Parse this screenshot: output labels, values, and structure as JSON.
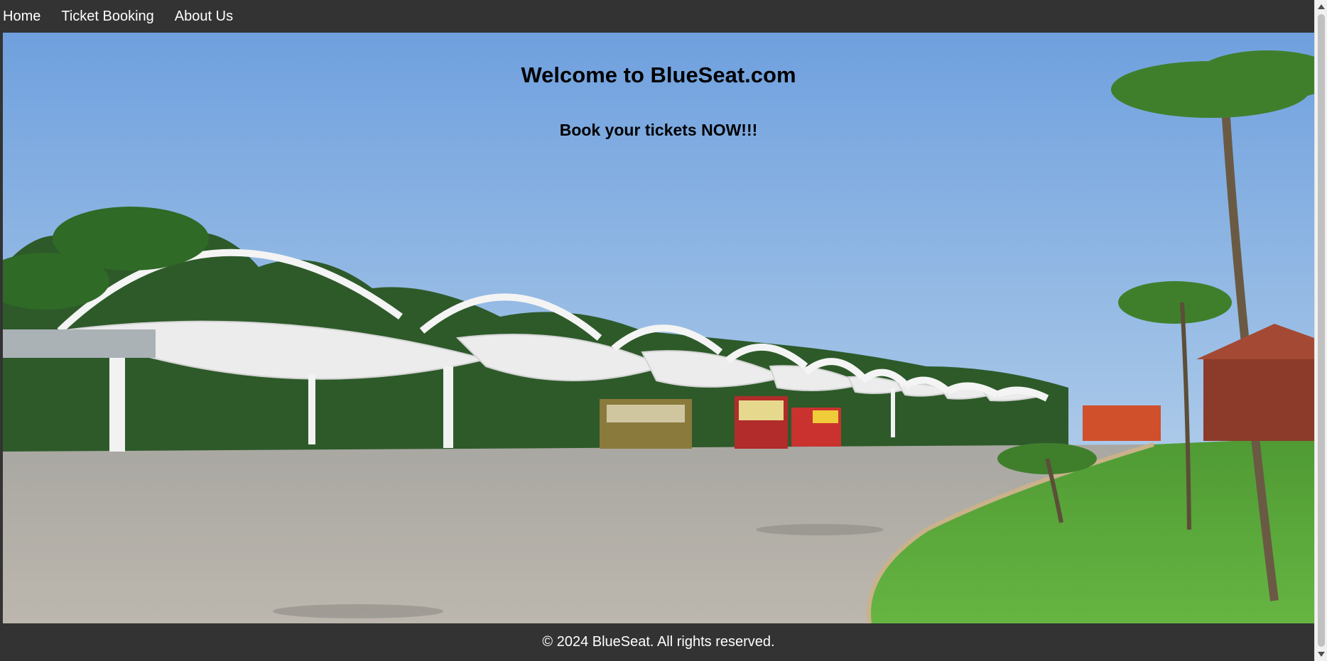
{
  "nav": {
    "items": [
      {
        "label": "Home"
      },
      {
        "label": "Ticket Booking"
      },
      {
        "label": "About Us"
      }
    ]
  },
  "hero": {
    "title": "Welcome to BlueSeat.com",
    "subtitle": "Book your tickets NOW!!!",
    "image": "bus-station-photo"
  },
  "footer": {
    "text": "© 2024 BlueSeat. All rights reserved."
  },
  "colors": {
    "nav_bg": "#333333",
    "footer_bg": "#333333",
    "text_light": "#ffffff",
    "sky": "#8fb4e0",
    "grass": "#5aa83a",
    "pavement": "#b7b4ad"
  }
}
